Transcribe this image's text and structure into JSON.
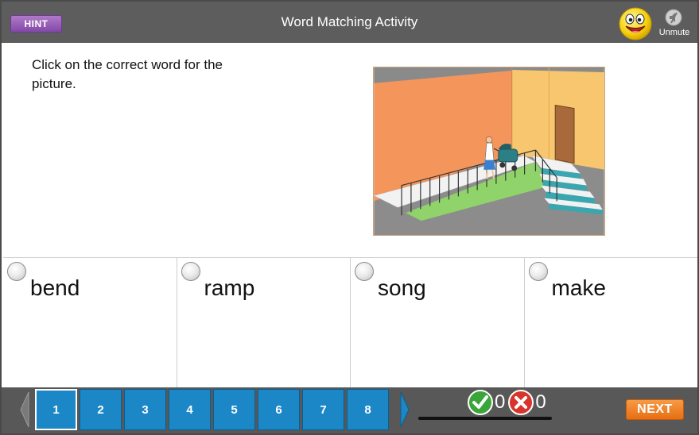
{
  "header": {
    "title": "Word Matching Activity",
    "hint_label": "HINT",
    "unmute_label": "Unmute",
    "mascot_icon": "smiley-face-icon",
    "sound_icon": "muted-speaker-icon"
  },
  "question": {
    "instruction": "Click on the correct word for the picture.",
    "picture_icon": "ramp-illustration"
  },
  "options": [
    {
      "word": "bend",
      "selected": false
    },
    {
      "word": "ramp",
      "selected": false
    },
    {
      "word": "song",
      "selected": false
    },
    {
      "word": "make",
      "selected": false
    }
  ],
  "footer": {
    "pages": [
      "1",
      "2",
      "3",
      "4",
      "5",
      "6",
      "7",
      "8"
    ],
    "current_page": "1",
    "correct_count": "0",
    "wrong_count": "0",
    "next_label": "NEXT"
  },
  "colors": {
    "header_bg": "#5d5d5d",
    "hint_purple": "#8348a8",
    "page_blue": "#1b87c6",
    "next_orange": "#e66f12",
    "correct_green": "#3aa63a",
    "wrong_red": "#d9342b"
  }
}
